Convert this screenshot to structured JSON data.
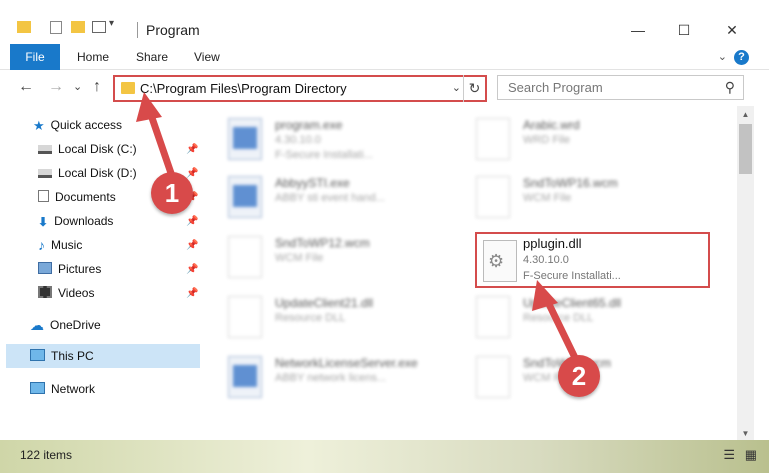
{
  "window": {
    "title": "Program",
    "minimize_glyph": "—",
    "maximize_glyph": "☐",
    "close_glyph": "✕"
  },
  "ribbon": {
    "file": "File",
    "home": "Home",
    "share": "Share",
    "view": "View",
    "help_glyph": "?",
    "expand_glyph": "⌄"
  },
  "address": {
    "path": "C:\\Program Files\\Program Directory",
    "chevron_glyph": "⌄",
    "refresh_glyph": "↻"
  },
  "search": {
    "placeholder": "Search Program",
    "icon_glyph": "⚲"
  },
  "nav": {
    "back_glyph": "←",
    "forward_glyph": "→",
    "history_glyph": "⌄",
    "up_glyph": "↑",
    "items": [
      {
        "label": "Quick access",
        "icon": "star-icon",
        "pinned": false
      },
      {
        "label": "Local Disk (C:)",
        "icon": "drive-icon",
        "pinned": true
      },
      {
        "label": "Local Disk (D:)",
        "icon": "drive-icon",
        "pinned": true
      },
      {
        "label": "Documents",
        "icon": "documents-icon",
        "pinned": true
      },
      {
        "label": "Downloads",
        "icon": "download-icon",
        "pinned": true
      },
      {
        "label": "Music",
        "icon": "music-icon",
        "pinned": true
      },
      {
        "label": "Pictures",
        "icon": "pictures-icon",
        "pinned": true
      },
      {
        "label": "Videos",
        "icon": "videos-icon",
        "pinned": true
      },
      {
        "label": "OneDrive",
        "icon": "cloud-icon",
        "pinned": false
      },
      {
        "label": "This PC",
        "icon": "computer-icon",
        "pinned": false
      },
      {
        "label": "Network",
        "icon": "network-icon",
        "pinned": false
      }
    ],
    "pin_glyph": "📌"
  },
  "files": [
    {
      "name": "program.exe",
      "line1": "4.30.10.0",
      "line2": "F-Secure Installati...",
      "type": "exe"
    },
    {
      "name": "Arabic.wrd",
      "line1": "WRD File",
      "line2": "",
      "type": "doc"
    },
    {
      "name": "AbbyySTI.exe",
      "line1": "ABBY sti event hand...",
      "line2": "",
      "type": "exe"
    },
    {
      "name": "SndToWP16.wcm",
      "line1": "WCM File",
      "line2": "",
      "type": "doc"
    },
    {
      "name": "SndToWP12.wcm",
      "line1": "WCM File",
      "line2": "",
      "type": "doc"
    },
    {
      "name": "UpdateClient21.dll",
      "line1": "Resource DLL",
      "line2": "",
      "type": "doc"
    },
    {
      "name": "UpdateClient65.dll",
      "line1": "Resource DLL",
      "line2": "",
      "type": "doc"
    },
    {
      "name": "NetworkLicenseServer.exe",
      "line1": "ABBY network licens...",
      "line2": "",
      "type": "exe"
    },
    {
      "name": "SndToWP7.wcm",
      "line1": "WCM File",
      "line2": "",
      "type": "doc"
    }
  ],
  "highlighted_file": {
    "name": "pplugin.dll",
    "version": "4.30.10.0",
    "description": "F-Secure Installati...",
    "icon": "gear-file-icon"
  },
  "status": {
    "item_count": "122 items"
  },
  "annotations": {
    "step1": "1",
    "step2": "2",
    "color": "#d84a4a"
  },
  "colors": {
    "accent": "#1979ca",
    "selection": "#cce4f7",
    "highlight_border": "#d44c4c",
    "folder": "#f3c543"
  }
}
